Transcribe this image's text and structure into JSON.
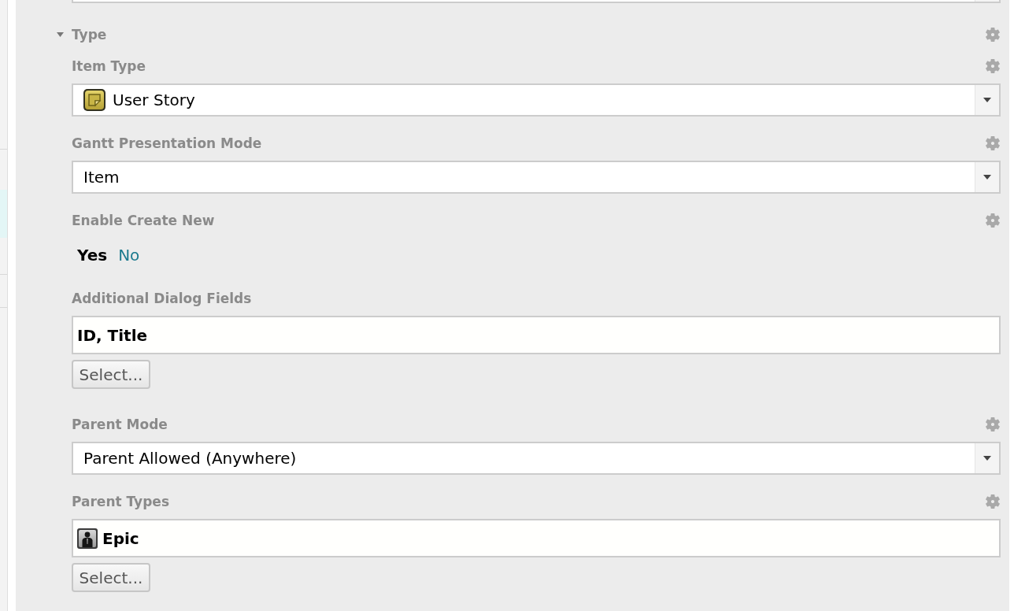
{
  "section": {
    "title": "Type",
    "expanded": true,
    "settings": true,
    "fields": [
      {
        "kind": "dropdown",
        "label": "Item Type",
        "settings": true,
        "value": "User Story"
      },
      {
        "kind": "dropdown",
        "label": "Gantt Presentation Mode",
        "settings": true,
        "value": "Item"
      },
      {
        "kind": "toggle",
        "label": "Enable Create New",
        "settings": true,
        "options": [
          {
            "label": "Yes",
            "selected": true
          },
          {
            "label": "No",
            "selected": false
          }
        ]
      },
      {
        "kind": "picker",
        "label": "Additional Dialog Fields",
        "settings": false,
        "value": "ID, Title",
        "button": "Select..."
      },
      {
        "kind": "dropdown",
        "label": "Parent Mode",
        "settings": true,
        "value": "Parent Allowed (Anywhere)"
      },
      {
        "kind": "picker",
        "label": "Parent Types",
        "settings": true,
        "value": "Epic",
        "button": "Select..."
      }
    ]
  }
}
